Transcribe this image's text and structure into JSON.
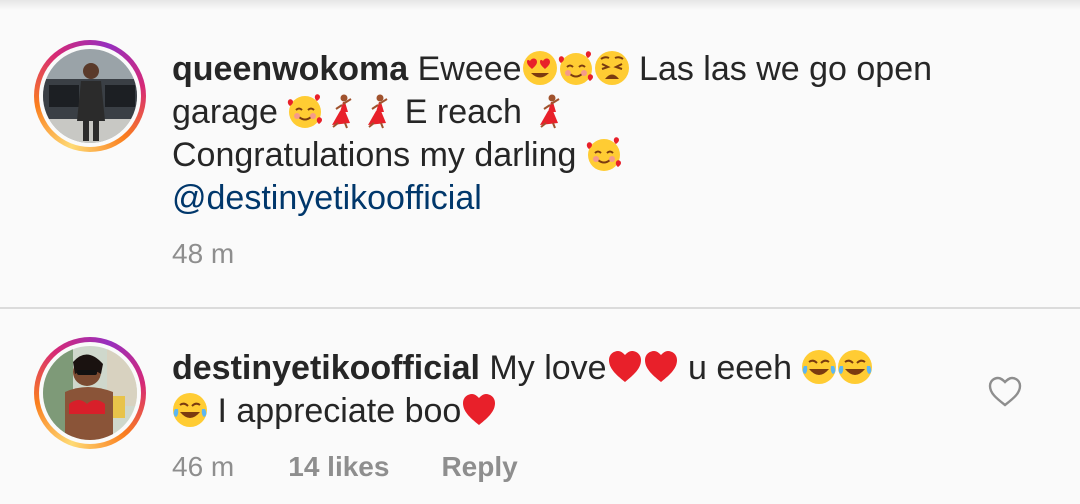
{
  "comments": [
    {
      "username": "queenwokoma",
      "line1_text": "Eweee",
      "line1_tail": " Las las we go open",
      "line2_start": "garage ",
      "line2_text": " E reach ",
      "line3": "Congratulations my darling ",
      "mention": "@destinyetikoofficial",
      "time": "48 m",
      "emojis": [
        "heart-eyes-emoji",
        "smiling-hearts-emoji",
        "weary-face-emoji",
        "smiling-hearts-emoji",
        "dancer-emoji",
        "dancer-emoji",
        "dancer-emoji",
        "smiling-hearts-emoji"
      ]
    },
    {
      "username": "destinyetikoofficial",
      "line1_text": "My love",
      "line1_tail": " u eeeh ",
      "line2_text": " I appreciate boo",
      "time": "46 m",
      "likes": "14 likes",
      "reply": "Reply",
      "emojis": [
        "red-heart-emoji",
        "red-heart-emoji",
        "tears-of-joy-emoji",
        "tears-of-joy-emoji",
        "tears-of-joy-emoji",
        "red-heart-emoji"
      ]
    }
  ],
  "colors": {
    "text": "#262626",
    "mention": "#00376b",
    "meta": "#8e8e8e",
    "background": "#fafafa"
  },
  "icons": {
    "like": "heart-outline-icon"
  }
}
